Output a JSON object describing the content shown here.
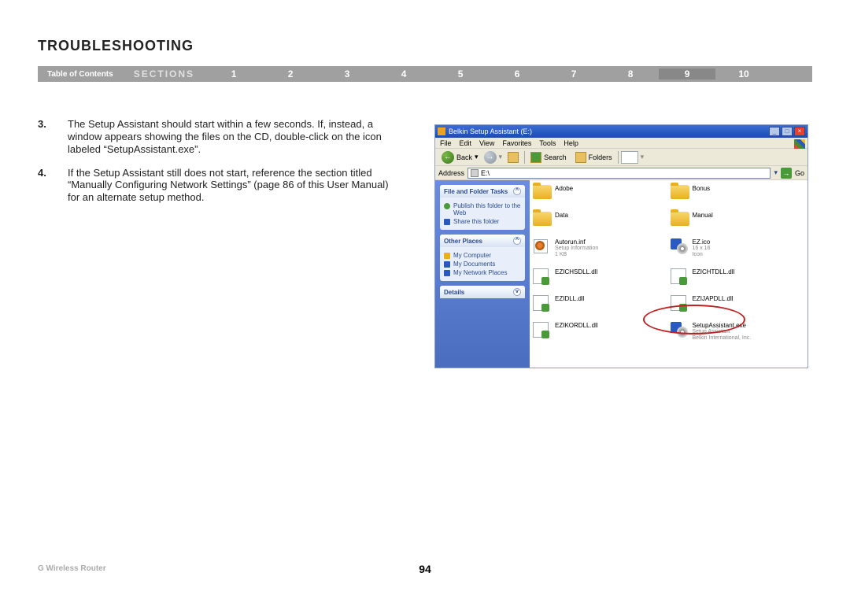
{
  "page": {
    "title": "TROUBLESHOOTING",
    "nav": {
      "toc": "Table of Contents",
      "sections_label": "SECTIONS",
      "numbers": [
        "1",
        "2",
        "3",
        "4",
        "5",
        "6",
        "7",
        "8",
        "9",
        "10"
      ],
      "active": "9"
    },
    "steps": [
      {
        "num": "3.",
        "text": "The Setup Assistant should start within a few seconds. If, instead, a window appears showing the files on the CD, double-click on the icon labeled “SetupAssistant.exe”."
      },
      {
        "num": "4.",
        "text": "If the Setup Assistant still does not start, reference the section titled “Manually Configuring Network Settings” (page 86 of this User Manual) for an alternate setup method."
      }
    ]
  },
  "screenshot": {
    "title": "Belkin Setup Assistant (E:)",
    "menus": [
      "File",
      "Edit",
      "View",
      "Favorites",
      "Tools",
      "Help"
    ],
    "toolbar": {
      "back": "Back",
      "search": "Search",
      "folders": "Folders"
    },
    "address": {
      "label": "Address",
      "value": "E:\\",
      "go": "Go"
    },
    "sidebar": {
      "panel1": {
        "title": "File and Folder Tasks",
        "items": [
          "Publish this folder to the Web",
          "Share this folder"
        ]
      },
      "panel2": {
        "title": "Other Places",
        "items": [
          "My Computer",
          "My Documents",
          "My Network Places"
        ]
      },
      "panel3": {
        "title": "Details"
      }
    },
    "files": {
      "row0": {
        "a": {
          "name": "Adobe"
        },
        "b": {
          "name": "Bonus"
        }
      },
      "row1": {
        "a": {
          "name": "Data"
        },
        "b": {
          "name": "Manual"
        }
      },
      "row2": {
        "a": {
          "name": "Autorun.inf",
          "meta1": "Setup Information",
          "meta2": "1 KB"
        },
        "b": {
          "name": "EZ.ico",
          "meta1": "16 x 16",
          "meta2": "Icon"
        }
      },
      "row3": {
        "a": {
          "name": "EZICHSDLL.dll"
        },
        "b": {
          "name": "EZICHTDLL.dll"
        }
      },
      "row4": {
        "a": {
          "name": "EZIDLL.dll"
        },
        "b": {
          "name": "EZIJAPDLL.dll"
        }
      },
      "row5": {
        "a": {
          "name": "EZIKORDLL.dll"
        },
        "b": {
          "name": "SetupAssistant.exe",
          "meta1": "Setup Assistant",
          "meta2": "Belkin International, Inc."
        }
      }
    }
  },
  "footer": {
    "product": "G Wireless Router",
    "page": "94"
  }
}
